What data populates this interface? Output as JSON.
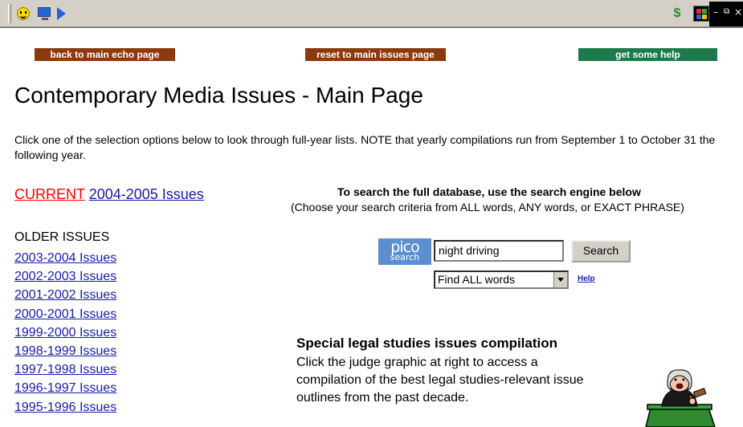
{
  "toolbar": {
    "icons": [
      "smiley-icon",
      "monitor-icon",
      "arrow-icon",
      "sync-icon",
      "windows-logo-icon"
    ],
    "controls": {
      "minimize": "–",
      "restore": "⧉",
      "close": "×"
    }
  },
  "nav": {
    "back": "back to main echo page",
    "reset": "reset to main issues page",
    "help": "get some help"
  },
  "colors": {
    "nav_brown": "#8b3a0e",
    "nav_green": "#1e7a4a",
    "link_blue": "#1a1aa8",
    "current_red": "#ff0000",
    "pico_blue": "#5b8fcf"
  },
  "page": {
    "title": "Contemporary Media Issues - Main Page",
    "intro": "Click one of the selection options below to look through full-year lists. NOTE that yearly compilations run from September 1 to October 31 the following year."
  },
  "current": {
    "prefix": "CURRENT",
    "link": "2004-2005 Issues"
  },
  "older": {
    "heading": "OLDER ISSUES",
    "items": [
      "2003-2004 Issues",
      "2002-2003 Issues",
      "2001-2002 Issues",
      "2000-2001 Issues",
      "1999-2000 Issues",
      "1998-1999 Issues",
      "1997-1998 Issues",
      "1996-1997 Issues",
      "1995-1996 Issues"
    ]
  },
  "search": {
    "title": "To search the full database, use the search engine below",
    "subtitle": "(Choose your search criteria from ALL words, ANY words, or EXACT PHRASE)",
    "logo_top": "pico",
    "logo_bottom": "search",
    "query": "night driving",
    "button": "Search",
    "mode_selected": "Find ALL words",
    "help": "Help"
  },
  "legal": {
    "title": "Special legal studies issues compilation",
    "text": "Click the judge graphic at right to access a compilation of the best legal studies-relevant issue outlines from the past decade."
  }
}
